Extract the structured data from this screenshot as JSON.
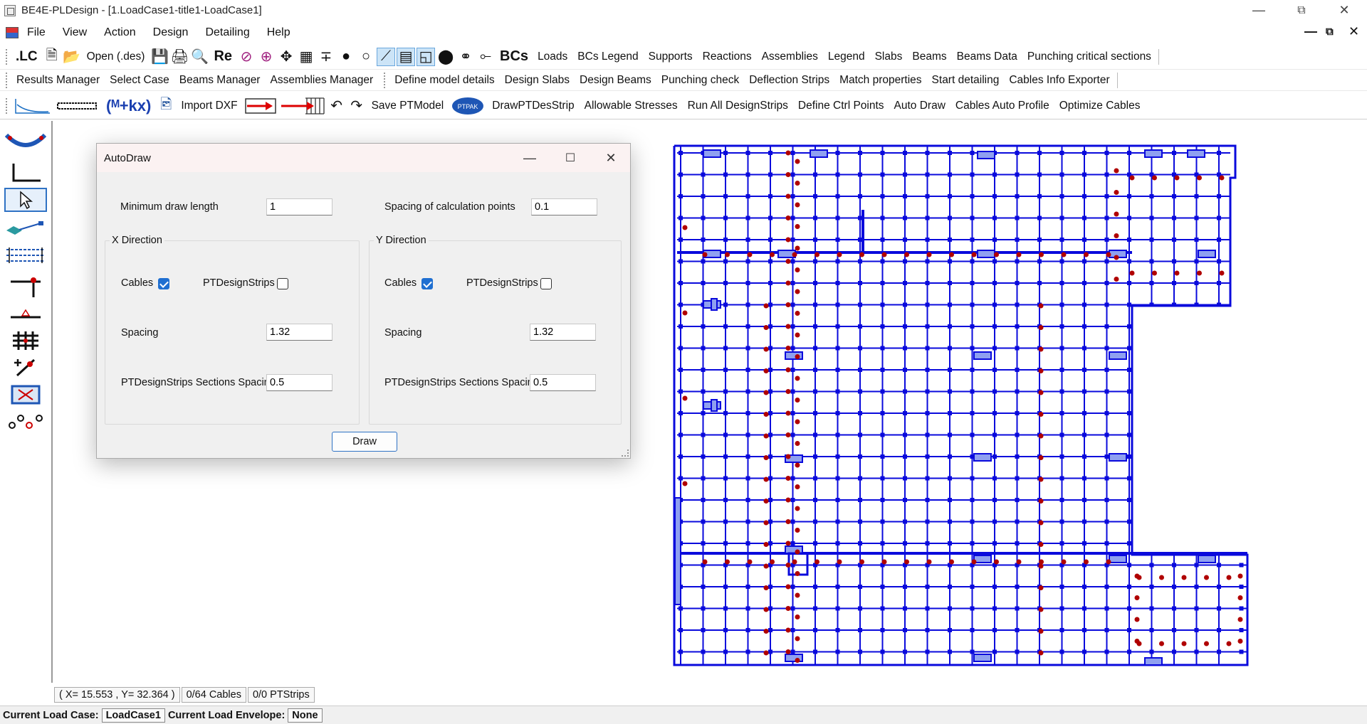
{
  "window": {
    "title": "BE4E-PLDesign - [1.LoadCase1-title1-LoadCase1]"
  },
  "menu": [
    "File",
    "View",
    "Action",
    "Design",
    "Detailing",
    "Help"
  ],
  "toolbar1": {
    "lc_label": ".LC",
    "open_label": "Open (.des)",
    "re_label": "Re",
    "bcs_label": "BCs",
    "items": [
      "Loads",
      "BCs Legend",
      "Supports",
      "Reactions",
      "Assemblies",
      "Legend",
      "Slabs",
      "Beams",
      "Beams Data",
      "Punching critical sections"
    ]
  },
  "toolbar2": {
    "items_a": [
      "Results Manager",
      "Select Case",
      "Beams Manager",
      "Assemblies Manager"
    ],
    "items_b": [
      "Define model details",
      "Design Slabs",
      "Design Beams",
      "Punching check",
      "Deflection Strips",
      "Match properties",
      "Start detailing",
      "Cables Info Exporter"
    ]
  },
  "toolbar3": {
    "formula_label": "(ᴹ+kx)",
    "import_label": "Import DXF",
    "save_label": "Save PTModel",
    "ptpak_label": "PTPAK",
    "items": [
      "DrawPTDesStrip",
      "Allowable Stresses",
      "Run All DesignStrips",
      "Define Ctrl Points",
      "Auto Draw",
      "Cables Auto Profile",
      "Optimize Cables"
    ]
  },
  "dialog": {
    "title": "AutoDraw",
    "min_draw_length_label": "Minimum draw length",
    "min_draw_length_value": "1",
    "spacing_calc_label": "Spacing of calculation points",
    "spacing_calc_value": "0.1",
    "x": {
      "title": "X Direction",
      "cables_label": "Cables",
      "cables_checked": true,
      "ptds_label": "PTDesignStrips",
      "ptds_checked": false,
      "spacing_label": "Spacing",
      "spacing_value": "1.32",
      "sections_label": "PTDesignStrips Sections Spacing",
      "sections_value": "0.5"
    },
    "y": {
      "title": "Y Direction",
      "cables_label": "Cables",
      "cables_checked": true,
      "ptds_label": "PTDesignStrips",
      "ptds_checked": false,
      "spacing_label": "Spacing",
      "spacing_value": "1.32",
      "sections_label": "PTDesignStrips Sections Spacing",
      "sections_value": "0.5"
    },
    "draw_button": "Draw"
  },
  "status": {
    "coords": "( X= 15.553 , Y= 32.364 )",
    "cables": "0/64 Cables",
    "ptstrips": "0/0 PTStrips",
    "load_case_label": "Current Load Case:",
    "load_case_value": "LoadCase1",
    "envelope_label": "Current Load Envelope:",
    "envelope_value": "None"
  },
  "colors": {
    "grid": "#0a0adc",
    "marker": "#b00000",
    "accent": "#2f72c4"
  }
}
